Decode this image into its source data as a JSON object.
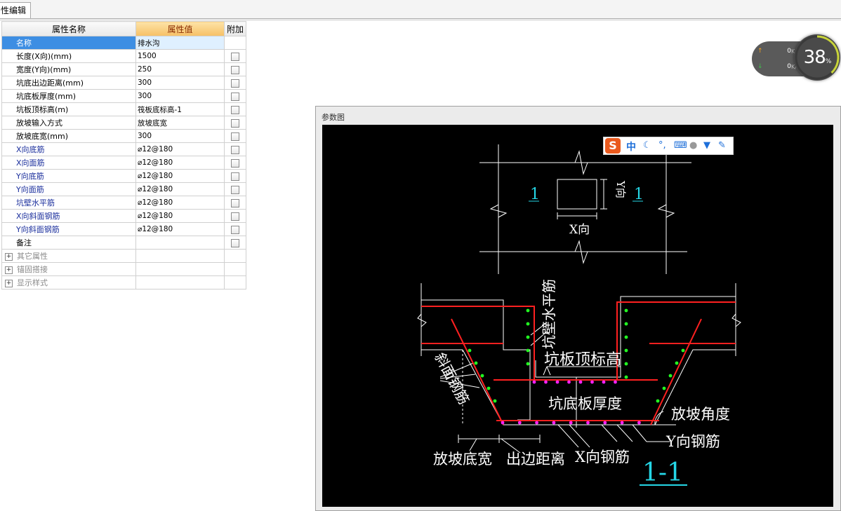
{
  "tab": {
    "label": "性编辑"
  },
  "grid": {
    "headers": {
      "name": "属性名称",
      "value": "属性值",
      "extra": "附加"
    },
    "rows": [
      {
        "name": "名称",
        "value": "排水沟",
        "check": false,
        "blue": false,
        "selected": true
      },
      {
        "name": "长度(X向)(mm)",
        "value": "1500",
        "check": true,
        "blue": false
      },
      {
        "name": "宽度(Y向)(mm)",
        "value": "250",
        "check": true,
        "blue": false
      },
      {
        "name": "坑底出边距离(mm)",
        "value": "300",
        "check": true,
        "blue": false
      },
      {
        "name": "坑底板厚度(mm)",
        "value": "300",
        "check": true,
        "blue": false
      },
      {
        "name": "坑板顶标高(m)",
        "value": "筏板底标高-1",
        "check": true,
        "blue": false
      },
      {
        "name": "放坡输入方式",
        "value": "放坡底宽",
        "check": true,
        "blue": false
      },
      {
        "name": "放坡底宽(mm)",
        "value": "300",
        "check": true,
        "blue": false
      },
      {
        "name": "X向底筋",
        "value": "⌀12@180",
        "check": true,
        "blue": true
      },
      {
        "name": "X向面筋",
        "value": "⌀12@180",
        "check": true,
        "blue": true
      },
      {
        "name": "Y向底筋",
        "value": "⌀12@180",
        "check": true,
        "blue": true
      },
      {
        "name": "Y向面筋",
        "value": "⌀12@180",
        "check": true,
        "blue": true
      },
      {
        "name": "坑壁水平筋",
        "value": "⌀12@180",
        "check": true,
        "blue": true
      },
      {
        "name": "X向斜面钢筋",
        "value": "⌀12@180",
        "check": true,
        "blue": true
      },
      {
        "name": "Y向斜面钢筋",
        "value": "⌀12@180",
        "check": true,
        "blue": true
      },
      {
        "name": "备注",
        "value": "",
        "check": true,
        "blue": false
      }
    ],
    "groups": [
      "其它属性",
      "锚固搭接",
      "显示样式"
    ]
  },
  "net": {
    "up_value": "0",
    "down_value": "0",
    "unit": "K/s",
    "percent": "38",
    "percent_sign": "%",
    "percent_fraction": 0.38
  },
  "panel": {
    "title": "参数图",
    "ime": {
      "logo": "S",
      "mode": "中"
    },
    "labels": {
      "plan_section_left": "1",
      "plan_section_right": "1",
      "plan_y": "Y向",
      "plan_x": "X向",
      "wall_bar": "坑壁水平筋",
      "top_elev": "坑板顶标高",
      "slope_bar": "斜面钢筋",
      "bottom_thick": "坑底板厚度",
      "slope_angle": "放坡角度",
      "y_bar": "Y向钢筋",
      "slope_width": "放坡底宽",
      "edge_dist": "出边距离",
      "x_bar": "X向钢筋",
      "section": "1-1"
    }
  }
}
